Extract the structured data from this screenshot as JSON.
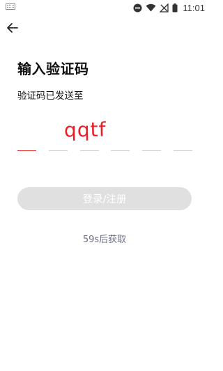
{
  "status_bar": {
    "time": "11:01",
    "icons": [
      "keyboard-icon",
      "do-not-disturb-icon",
      "wifi-icon",
      "no-signal-icon",
      "battery-icon"
    ]
  },
  "header": {
    "back_icon": "arrow-left-icon"
  },
  "main": {
    "title": "输入验证码",
    "subtitle": "验证码已发送至",
    "annotation": "qqtf",
    "code_slots": 6,
    "login_label": "登录/注册",
    "resend_label": "59s后获取"
  },
  "colors": {
    "accent": "#e0362b",
    "annotation": "#ee1c24",
    "button_disabled": "#e0e0e0",
    "resend_text": "#6d6d86",
    "slot_line": "#cfcfcf"
  }
}
